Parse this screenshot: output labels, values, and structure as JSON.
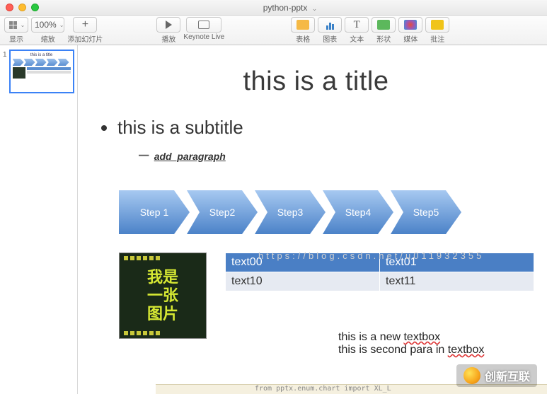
{
  "window": {
    "title": "python-pptx"
  },
  "toolbar": {
    "view": {
      "label": "显示"
    },
    "zoom": {
      "value": "100%",
      "label": "缩放"
    },
    "add_slide": {
      "symbol": "+",
      "label": "添加幻灯片"
    },
    "play": {
      "label": "播放"
    },
    "keynote_live": {
      "label": "Keynote Live"
    },
    "table": {
      "label": "表格"
    },
    "chart": {
      "label": "图表"
    },
    "text": {
      "symbol": "T",
      "label": "文本"
    },
    "shape": {
      "label": "形状"
    },
    "media": {
      "label": "媒体"
    },
    "comment": {
      "label": "批注"
    }
  },
  "sidebar": {
    "slide_index": "1"
  },
  "slide": {
    "title": "this is a title",
    "subtitle": "this is a subtitle",
    "sub_paragraph": "add_paragraph",
    "watermark": "https://blog.csdn.net/u011932355",
    "steps": [
      "Step 1",
      "Step2",
      "Step3",
      "Step4",
      "Step5"
    ],
    "image_text": [
      "我是",
      "一张",
      "图片"
    ],
    "table": {
      "header": [
        "text00",
        "text01"
      ],
      "row": [
        "text10",
        "text11"
      ]
    },
    "textbox": {
      "line1_a": "this is a new ",
      "line1_b": "textbox",
      "line2_a": "this is second para in ",
      "line2_b": "textbox"
    }
  },
  "footer_code": "from pptx.enum.chart import XL_L",
  "brand": "创新互联"
}
